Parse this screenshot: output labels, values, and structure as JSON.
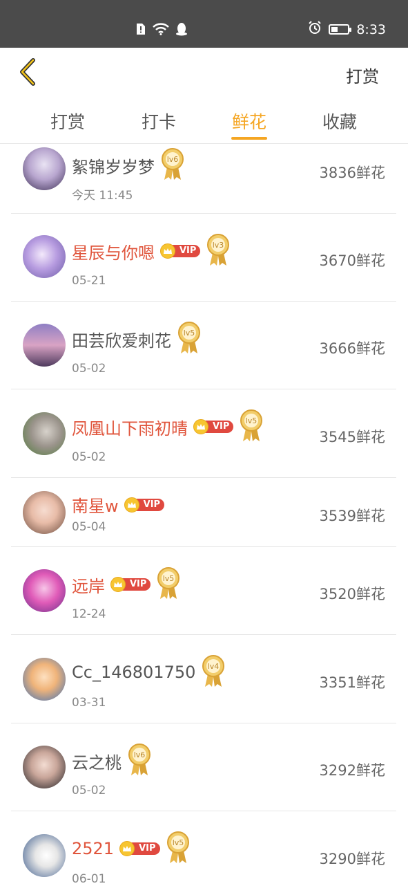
{
  "status": {
    "time": "8:33"
  },
  "header": {
    "action_label": "打赏"
  },
  "tabs": [
    {
      "label": "打赏",
      "active": false
    },
    {
      "label": "打卡",
      "active": false
    },
    {
      "label": "鲜花",
      "active": true
    },
    {
      "label": "收藏",
      "active": false
    }
  ],
  "vip_label": "VIP",
  "colors": {
    "accent": "#f5a623",
    "vip_name": "#e0553c",
    "vip_badge": "#e0493f",
    "medal_gold": "#e8b64a"
  },
  "rows": [
    {
      "name": "絮锦岁岁梦",
      "vip": false,
      "level": "lv6",
      "date": "今天 11:45",
      "amount": "3836鲜花"
    },
    {
      "name": "星辰与你嗯",
      "vip": true,
      "level": "lv3",
      "date": "05-21",
      "amount": "3670鲜花"
    },
    {
      "name": "田芸欣爱刺花",
      "vip": false,
      "level": "lv5",
      "date": "05-02",
      "amount": "3666鲜花"
    },
    {
      "name": "凤凰山下雨初晴",
      "vip": true,
      "level": "lv5",
      "date": "05-02",
      "amount": "3545鲜花"
    },
    {
      "name": "南星w",
      "vip": true,
      "level": "",
      "date": "05-04",
      "amount": "3539鲜花"
    },
    {
      "name": "远岸",
      "vip": true,
      "level": "lv5",
      "date": "12-24",
      "amount": "3520鲜花"
    },
    {
      "name": "Cc_146801750",
      "vip": false,
      "level": "lv4",
      "date": "03-31",
      "amount": "3351鲜花"
    },
    {
      "name": "云之桃",
      "vip": false,
      "level": "lv6",
      "date": "05-02",
      "amount": "3292鲜花"
    },
    {
      "name": "2521",
      "vip": true,
      "level": "lv5",
      "date": "06-01",
      "amount": "3290鲜花"
    }
  ]
}
